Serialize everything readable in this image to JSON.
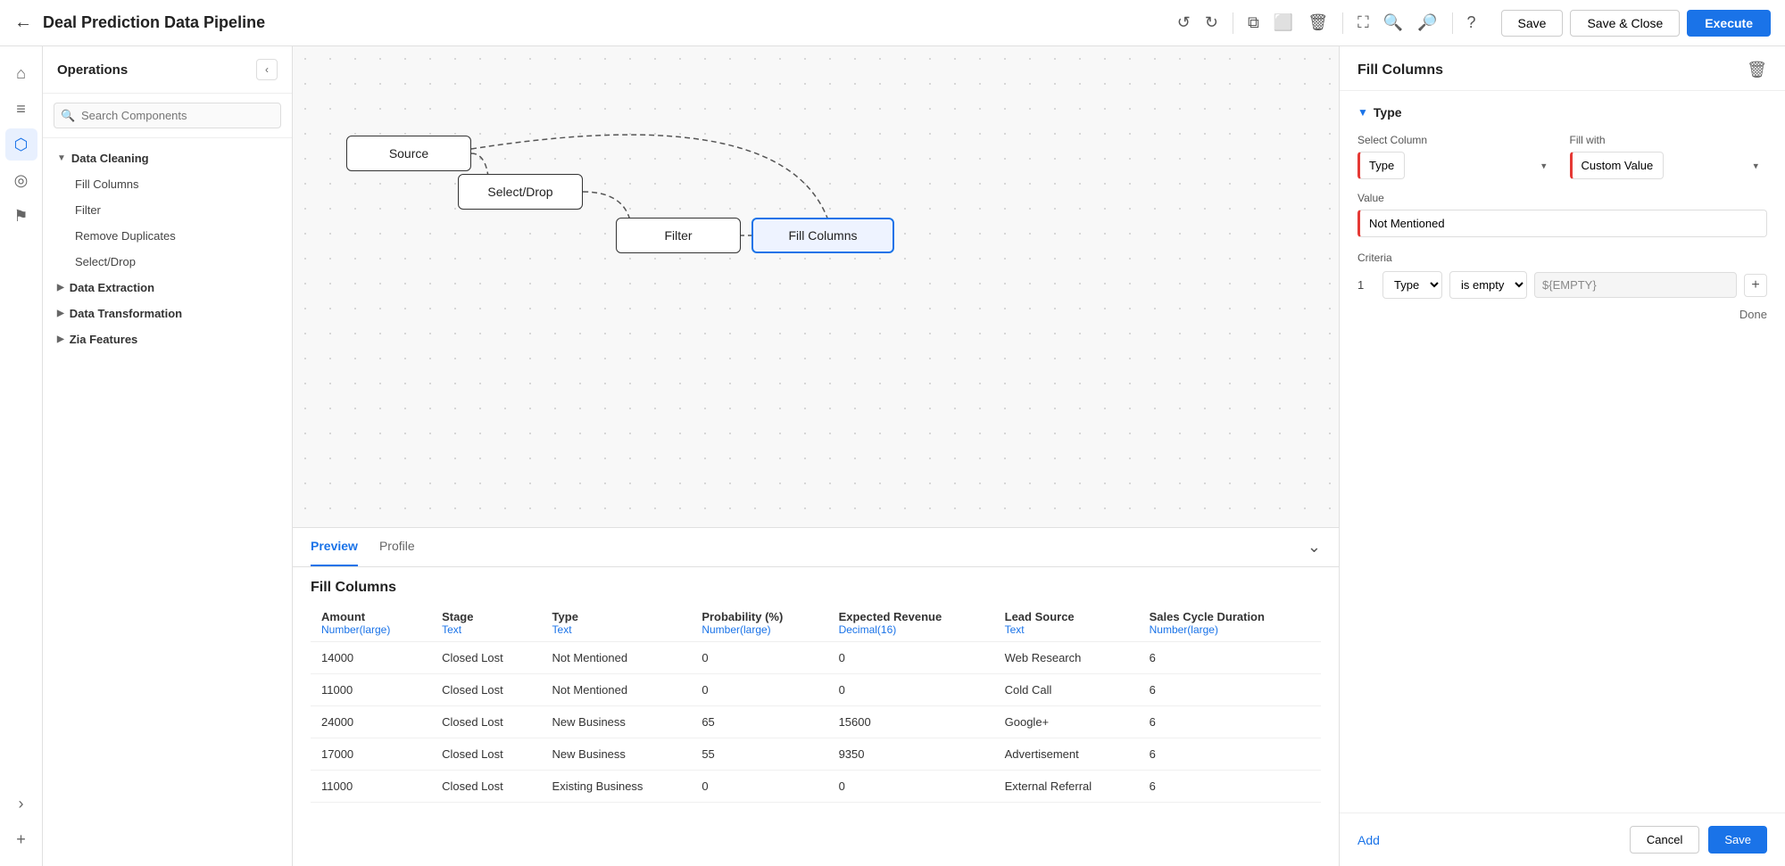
{
  "app": {
    "title": "Deal Prediction Data Pipeline",
    "back_label": "←"
  },
  "toolbar": {
    "undo_label": "↺",
    "redo_label": "↻",
    "copy_label": "⧉",
    "paste_label": "⬜",
    "delete_label": "🗑",
    "fit_label": "⛶",
    "zoom_in_label": "🔍",
    "zoom_out_label": "🔎",
    "help_label": "?",
    "save_label": "Save",
    "save_close_label": "Save & Close",
    "execute_label": "Execute"
  },
  "ops_panel": {
    "title": "Operations",
    "collapse_icon": "‹",
    "search_placeholder": "Search Components",
    "groups": [
      {
        "name": "Data Cleaning",
        "expanded": true,
        "items": [
          "Fill Columns",
          "Filter",
          "Remove Duplicates",
          "Select/Drop"
        ]
      },
      {
        "name": "Data Extraction",
        "expanded": false,
        "items": []
      },
      {
        "name": "Data Transformation",
        "expanded": false,
        "items": []
      },
      {
        "name": "Zia Features",
        "expanded": false,
        "items": []
      }
    ]
  },
  "pipeline": {
    "nodes": [
      {
        "id": "source",
        "label": "Source"
      },
      {
        "id": "selectdrop",
        "label": "Select/Drop"
      },
      {
        "id": "filter",
        "label": "Filter"
      },
      {
        "id": "fillcols",
        "label": "Fill Columns"
      }
    ]
  },
  "right_panel": {
    "title": "Fill Columns",
    "section_label": "Type",
    "select_column_label": "Select Column",
    "select_column_value": "Type",
    "fill_with_label": "Fill with",
    "fill_with_value": "Custom Value",
    "value_label": "Value",
    "value_value": "Not Mentioned",
    "criteria_label": "Criteria",
    "criteria_row": {
      "num": "1",
      "column": "Type",
      "condition": "is empty",
      "value": "${EMPTY}"
    },
    "done_label": "Done",
    "add_label": "Add",
    "cancel_label": "Cancel",
    "save_label": "Save",
    "delete_icon": "🗑"
  },
  "preview": {
    "tabs": [
      "Preview",
      "Profile"
    ],
    "active_tab": "Preview",
    "section_title": "Fill Columns",
    "expand_icon": "⌄",
    "columns": [
      {
        "name": "Amount",
        "type": "Number(large)"
      },
      {
        "name": "Stage",
        "type": "Text"
      },
      {
        "name": "Type",
        "type": "Text"
      },
      {
        "name": "Probability (%)",
        "type": "Number(large)"
      },
      {
        "name": "Expected Revenue",
        "type": "Decimal(16)"
      },
      {
        "name": "Lead Source",
        "type": "Text"
      },
      {
        "name": "Sales Cycle Duration",
        "type": "Number(large)"
      }
    ],
    "rows": [
      [
        "14000",
        "Closed Lost",
        "Not Mentioned",
        "0",
        "0",
        "Web Research",
        "6"
      ],
      [
        "11000",
        "Closed Lost",
        "Not Mentioned",
        "0",
        "0",
        "Cold Call",
        "6"
      ],
      [
        "24000",
        "Closed Lost",
        "New Business",
        "65",
        "15600",
        "Google+",
        "6"
      ],
      [
        "17000",
        "Closed Lost",
        "New Business",
        "55",
        "9350",
        "Advertisement",
        "6"
      ],
      [
        "11000",
        "Closed Lost",
        "Existing Business",
        "0",
        "0",
        "External Referral",
        "6"
      ]
    ]
  },
  "icon_sidebar": {
    "icons": [
      {
        "name": "home-icon",
        "symbol": "⌂",
        "active": false
      },
      {
        "name": "data-icon",
        "symbol": "≡",
        "active": false
      },
      {
        "name": "pipeline-icon",
        "symbol": "⬡",
        "active": true
      },
      {
        "name": "chart-icon",
        "symbol": "◎",
        "active": false
      },
      {
        "name": "flag-icon",
        "symbol": "⚑",
        "active": false
      }
    ],
    "bottom": [
      {
        "name": "collapse-icon",
        "symbol": "›"
      },
      {
        "name": "add-icon",
        "symbol": "+"
      }
    ]
  }
}
